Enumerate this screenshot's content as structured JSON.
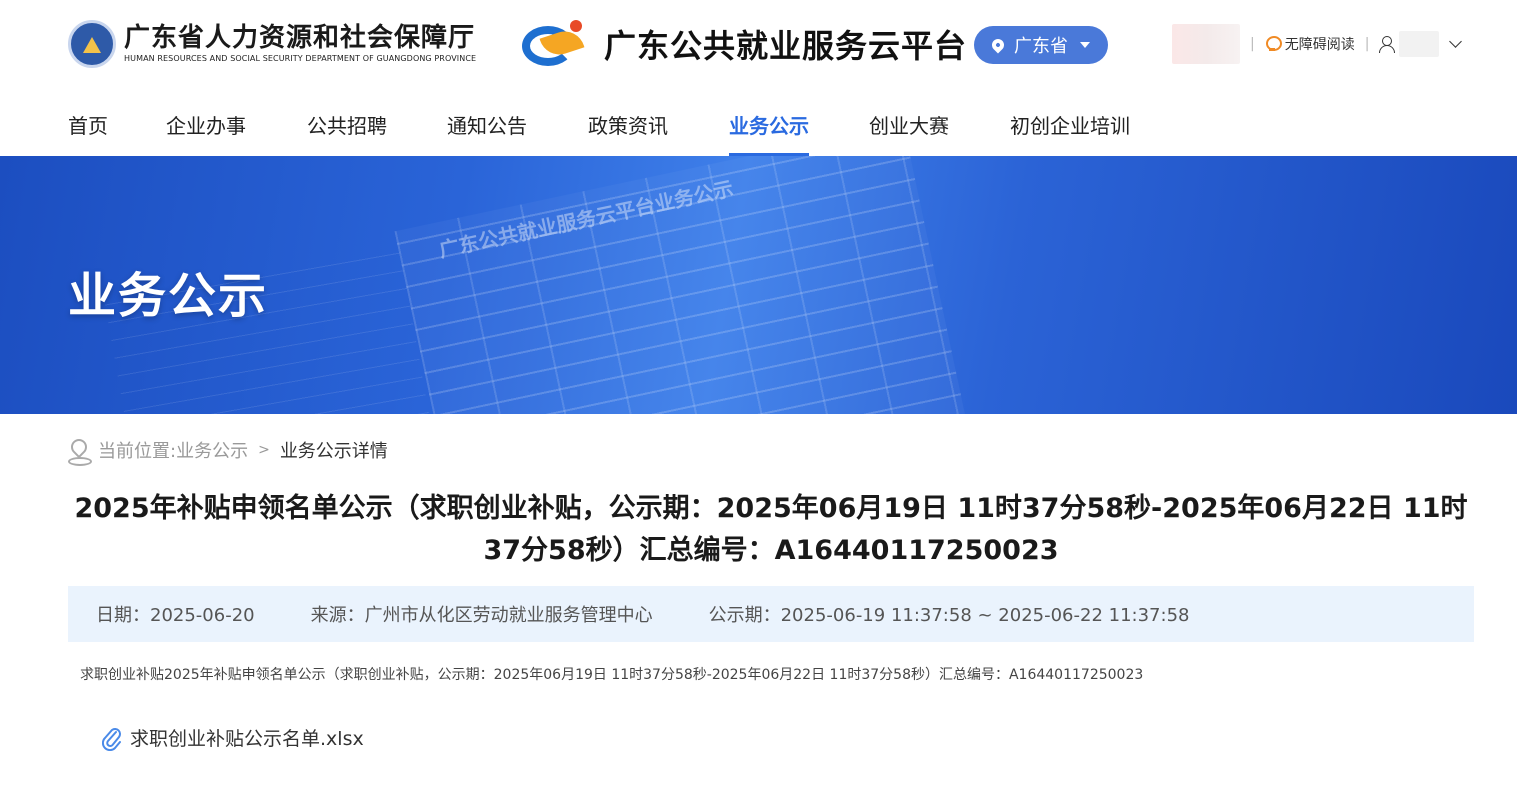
{
  "header": {
    "org_name_cn": "广东省人力资源和社会保障厅",
    "org_name_en": "HUMAN RESOURCES AND SOCIAL SECURITY DEPARTMENT OF GUANGDONG PROVINCE",
    "platform_name": "广东公共就业服务云平台",
    "region": "广东省",
    "accessibility_label": "无障碍阅读"
  },
  "nav": {
    "items": [
      "首页",
      "企业办事",
      "公共招聘",
      "通知公告",
      "政策资讯",
      "业务公示",
      "创业大赛",
      "初创企业培训"
    ],
    "active_index": 5
  },
  "banner": {
    "title": "业务公示",
    "sheet_text": "广东公共就业服务云平台业务公示"
  },
  "breadcrumb": {
    "label": "当前位置:",
    "link": "业务公示",
    "separator": ">",
    "current": "业务公示详情"
  },
  "article": {
    "title": "2025年补贴申领名单公示（求职创业补贴，公示期：2025年06月19日 11时37分58秒-2025年06月22日 11时37分58秒）汇总编号：A16440117250023",
    "date": "日期：2025-06-20",
    "source": "来源：广州市从化区劳动就业服务管理中心",
    "period": "公示期：2025-06-19 11:37:58 ~ 2025-06-22 11:37:58",
    "summary": "求职创业补贴2025年补贴申领名单公示（求职创业补贴，公示期：2025年06月19日 11时37分58秒-2025年06月22日 11时37分58秒）汇总编号：A16440117250023",
    "attachment": "求职创业补贴公示名单.xlsx"
  },
  "colors": {
    "accent": "#2a6ae0",
    "region_button": "#4a79d9",
    "meta_bg": "#eaf3fd",
    "banner": "#2a64d8"
  }
}
